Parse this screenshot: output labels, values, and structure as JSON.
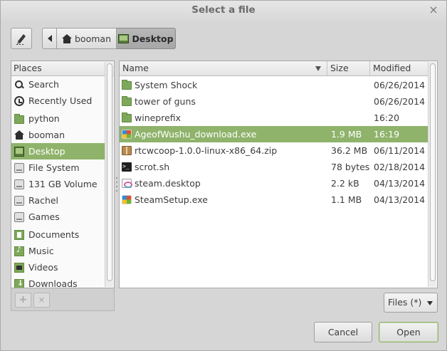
{
  "window": {
    "title": "Select a file",
    "close_glyph": "×"
  },
  "toolbar": {
    "edit_icon": "pencil-icon",
    "back_icon": "left-arrow-icon",
    "breadcrumbs": [
      {
        "label": "booman",
        "icon": "home-icon"
      },
      {
        "label": "Desktop",
        "icon": "desktop-icon",
        "active": true
      }
    ]
  },
  "places": {
    "header": "Places",
    "items": [
      {
        "label": "Search",
        "icon": "search-icon"
      },
      {
        "label": "Recently Used",
        "icon": "recent-icon"
      },
      {
        "label": "python",
        "icon": "folder-icon"
      },
      {
        "label": "booman",
        "icon": "home-icon"
      },
      {
        "label": "Desktop",
        "icon": "desktop-icon",
        "selected": true
      },
      {
        "label": "File System",
        "icon": "drive-icon"
      },
      {
        "label": "131 GB Volume",
        "icon": "drive-icon"
      },
      {
        "label": "Rachel",
        "icon": "drive-icon"
      },
      {
        "label": "Games",
        "icon": "drive-icon"
      },
      {
        "label": "Documents",
        "icon": "documents-folder-icon"
      },
      {
        "label": "Music",
        "icon": "music-folder-icon"
      },
      {
        "label": "Videos",
        "icon": "videos-folder-icon"
      },
      {
        "label": "Downloads",
        "icon": "downloads-folder-icon"
      }
    ],
    "add_label": "+",
    "remove_label": "✕"
  },
  "files": {
    "columns": {
      "name": "Name",
      "size": "Size",
      "modified": "Modified"
    },
    "rows": [
      {
        "name": "System Shock",
        "size": "",
        "modified": "06/26/2014",
        "icon": "folder-icon"
      },
      {
        "name": "tower of guns",
        "size": "",
        "modified": "06/26/2014",
        "icon": "folder-icon"
      },
      {
        "name": "wineprefix",
        "size": "",
        "modified": "16:20",
        "icon": "folder-icon"
      },
      {
        "name": "AgeofWushu_download.exe",
        "size": "1.9 MB",
        "modified": "16:19",
        "icon": "exe-icon",
        "selected": true
      },
      {
        "name": "rtcwcoop-1.0.0-linux-x86_64.zip",
        "size": "36.2 MB",
        "modified": "06/11/2014",
        "icon": "archive-icon"
      },
      {
        "name": "scrot.sh",
        "size": "78 bytes",
        "modified": "02/18/2014",
        "icon": "terminal-icon"
      },
      {
        "name": "steam.desktop",
        "size": "2.2 kB",
        "modified": "04/13/2014",
        "icon": "desktop-file-icon"
      },
      {
        "name": "SteamSetup.exe",
        "size": "1.1 MB",
        "modified": "04/13/2014",
        "icon": "exe-icon"
      }
    ]
  },
  "filter": {
    "selected": "Files (*)"
  },
  "buttons": {
    "cancel": "Cancel",
    "open": "Open"
  },
  "colors": {
    "selection": "#8fb36b",
    "folder": "#7ea85a"
  }
}
